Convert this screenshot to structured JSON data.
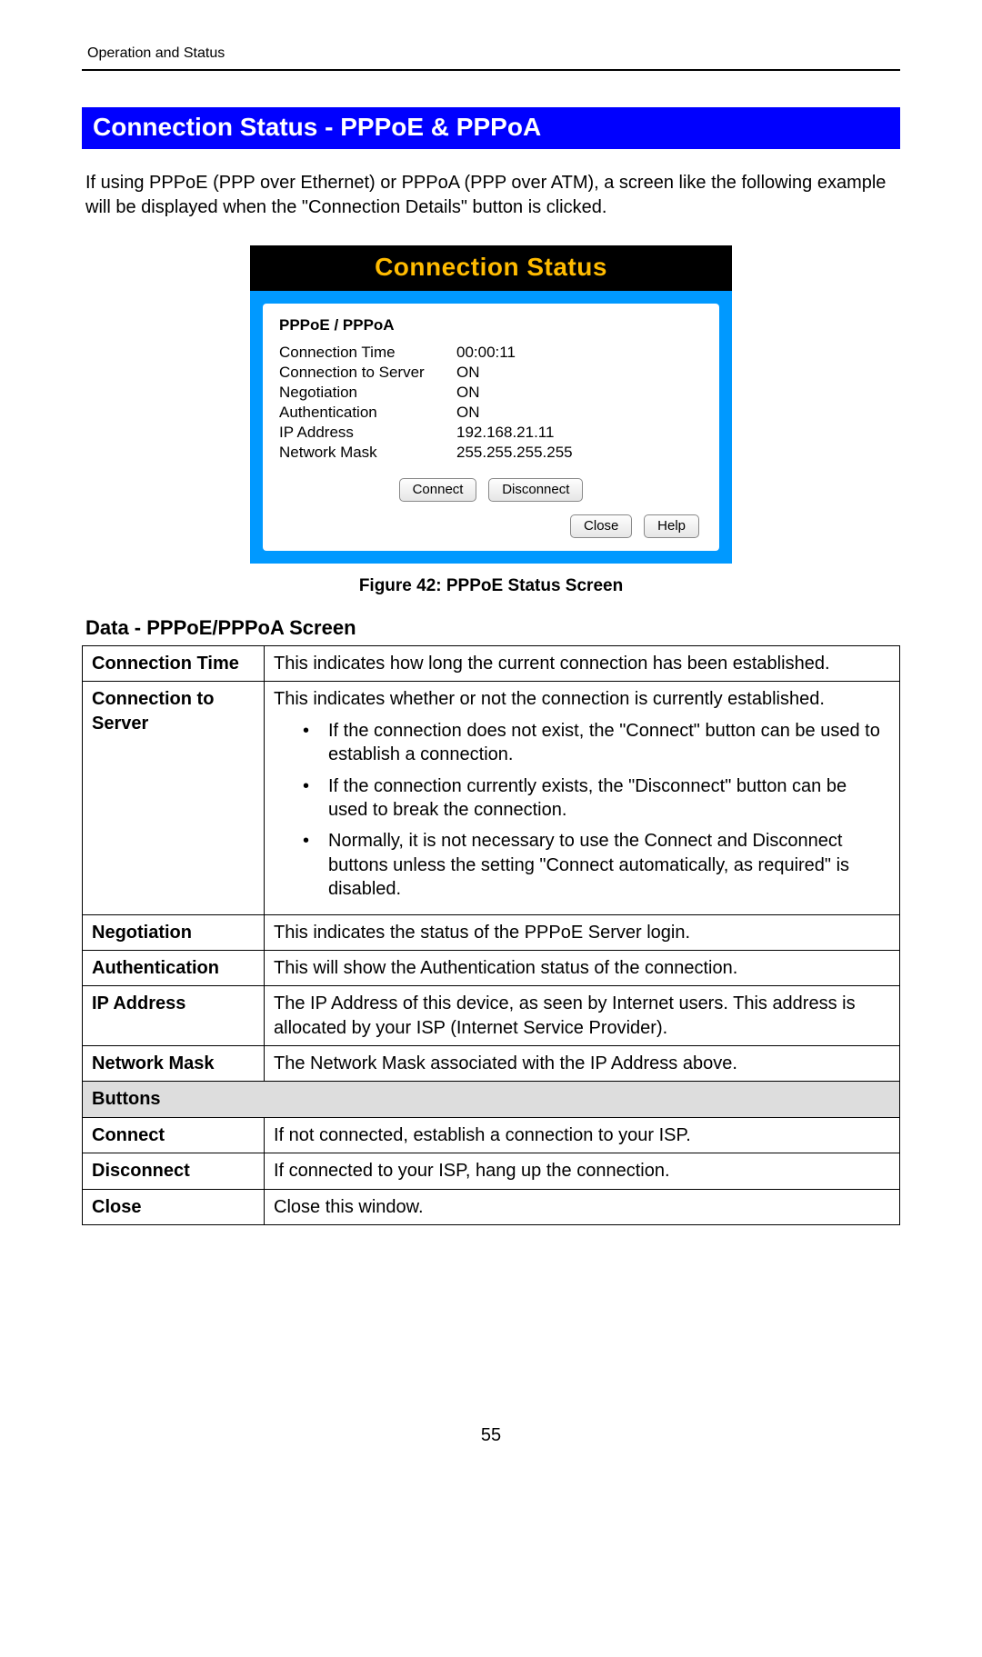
{
  "header": {
    "chapter": "Operation and Status"
  },
  "section": {
    "title": "Connection Status - PPPoE & PPPoA"
  },
  "intro": "If using PPPoE (PPP over Ethernet) or PPPoA (PPP over ATM), a screen like the following example will be displayed when the \"Connection Details\" button is clicked.",
  "status": {
    "frameTitle": "Connection Status",
    "panelTitle": "PPPoE / PPPoA",
    "rows": [
      {
        "label": "Connection Time",
        "value": "00:00:11"
      },
      {
        "label": "Connection to Server",
        "value": "ON"
      },
      {
        "label": "Negotiation",
        "value": "ON"
      },
      {
        "label": "Authentication",
        "value": "ON"
      },
      {
        "label": "IP Address",
        "value": "192.168.21.11"
      },
      {
        "label": "Network Mask",
        "value": "255.255.255.255"
      }
    ],
    "buttons": {
      "connect": "Connect",
      "disconnect": "Disconnect",
      "close": "Close",
      "help": "Help"
    }
  },
  "figureCaption": "Figure 42: PPPoE Status Screen",
  "dataHeading": "Data - PPPoE/PPPoA Screen",
  "table": {
    "rows": [
      {
        "label": "Connection Time",
        "desc": "This indicates how long the current connection has been established."
      },
      {
        "label": "Connection to Server",
        "desc": "This indicates whether or not the connection is currently established.",
        "bullets": [
          "If the connection does not exist, the \"Connect\" button can be used to establish a connection.",
          "If the connection currently exists, the \"Disconnect\" button can be used to break the connection.",
          "Normally, it is not necessary to use the Connect and Disconnect buttons unless the setting \"Connect automatically, as required\" is disabled."
        ]
      },
      {
        "label": "Negotiation",
        "desc": "This indicates the status of the PPPoE Server login."
      },
      {
        "label": "Authentication",
        "desc": "This will show the Authentication status of the connection."
      },
      {
        "label": "IP Address",
        "desc": "The IP Address of this device, as seen by Internet users. This address is allocated by your ISP (Internet Service Provider)."
      },
      {
        "label": "Network Mask",
        "desc": "The Network Mask associated with the IP Address above."
      }
    ],
    "buttonsSection": "Buttons",
    "buttonRows": [
      {
        "label": "Connect",
        "desc": "If not connected, establish a connection to your ISP."
      },
      {
        "label": "Disconnect",
        "desc": "If connected to your ISP, hang up the connection."
      },
      {
        "label": "Close",
        "desc": "Close this window."
      }
    ]
  },
  "pageNumber": "55"
}
